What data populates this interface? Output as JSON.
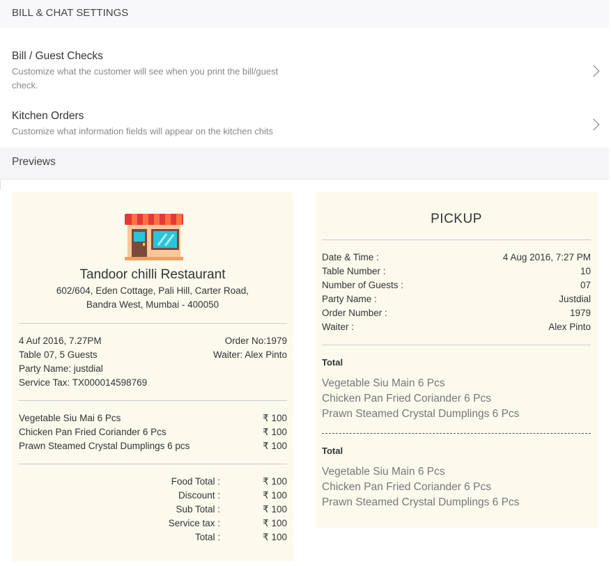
{
  "header": {
    "title": "BILL & CHAT SETTINGS"
  },
  "settings": [
    {
      "title": "Bill / Guest Checks",
      "description": "Customize what the customer will see when you print the bill/guest check."
    },
    {
      "title": "Kitchen Orders",
      "description": "Customize what information fields will appear on the kitchen chits"
    }
  ],
  "previews": {
    "label": "Previews"
  },
  "bill": {
    "icon": "store-front-icon",
    "restaurant_name": "Tandoor chilli Restaurant",
    "address_line1": "602/604, Eden Cottage, Pali Hill, Carter Road,",
    "address_line2": "Bandra West, Mumbai - 400050",
    "datetime": "4 Auf 2016, 7.27PM",
    "order_no": "Order No:1979",
    "table": "Table 07, 5 Guests",
    "waiter": "Waiter: Alex Pinto",
    "party": "Party Name: justdial",
    "service_tax_no": "Service Tax: TX000014598769",
    "items": [
      {
        "name": "Vegetable Siu Mai 6 Pcs",
        "price": "₹ 100"
      },
      {
        "name": "Chicken Pan Fried Coriander 6 Pcs",
        "price": "₹ 100"
      },
      {
        "name": "Prawn Steamed Crystal Dumplings 6 pcs",
        "price": "₹ 100"
      }
    ],
    "totals": [
      {
        "label": "Food Total :",
        "value": "₹ 100"
      },
      {
        "label": "Discount :",
        "value": "₹ 100"
      },
      {
        "label": "Sub Total :",
        "value": "₹ 100"
      },
      {
        "label": "Service tax :",
        "value": "₹ 100"
      },
      {
        "label": "Total :",
        "value": "₹ 100"
      }
    ]
  },
  "kitchen": {
    "title": "PICKUP",
    "fields": [
      {
        "label": "Date & Time :",
        "value": "4 Aug 2016, 7:27 PM"
      },
      {
        "label": "Table Number :",
        "value": "10"
      },
      {
        "label": "Number of Guests :",
        "value": "07"
      },
      {
        "label": "Party Name :",
        "value": "Justdial"
      },
      {
        "label": "Order Number :",
        "value": "1979"
      },
      {
        "label": "Waiter :",
        "value": "Alex Pinto"
      }
    ],
    "sections": [
      {
        "heading": "Total",
        "items": [
          "Vegetable Siu Main 6 Pcs",
          "Chicken Pan Fried Coriander 6 Pcs",
          "Prawn Steamed Crystal Dumplings 6 Pcs"
        ]
      },
      {
        "heading": "Total",
        "items": [
          "Vegetable Siu Main 6 Pcs",
          "Chicken Pan Fried Coriander 6 Pcs",
          "Prawn Steamed Crystal Dumplings 6 Pcs"
        ]
      }
    ]
  }
}
